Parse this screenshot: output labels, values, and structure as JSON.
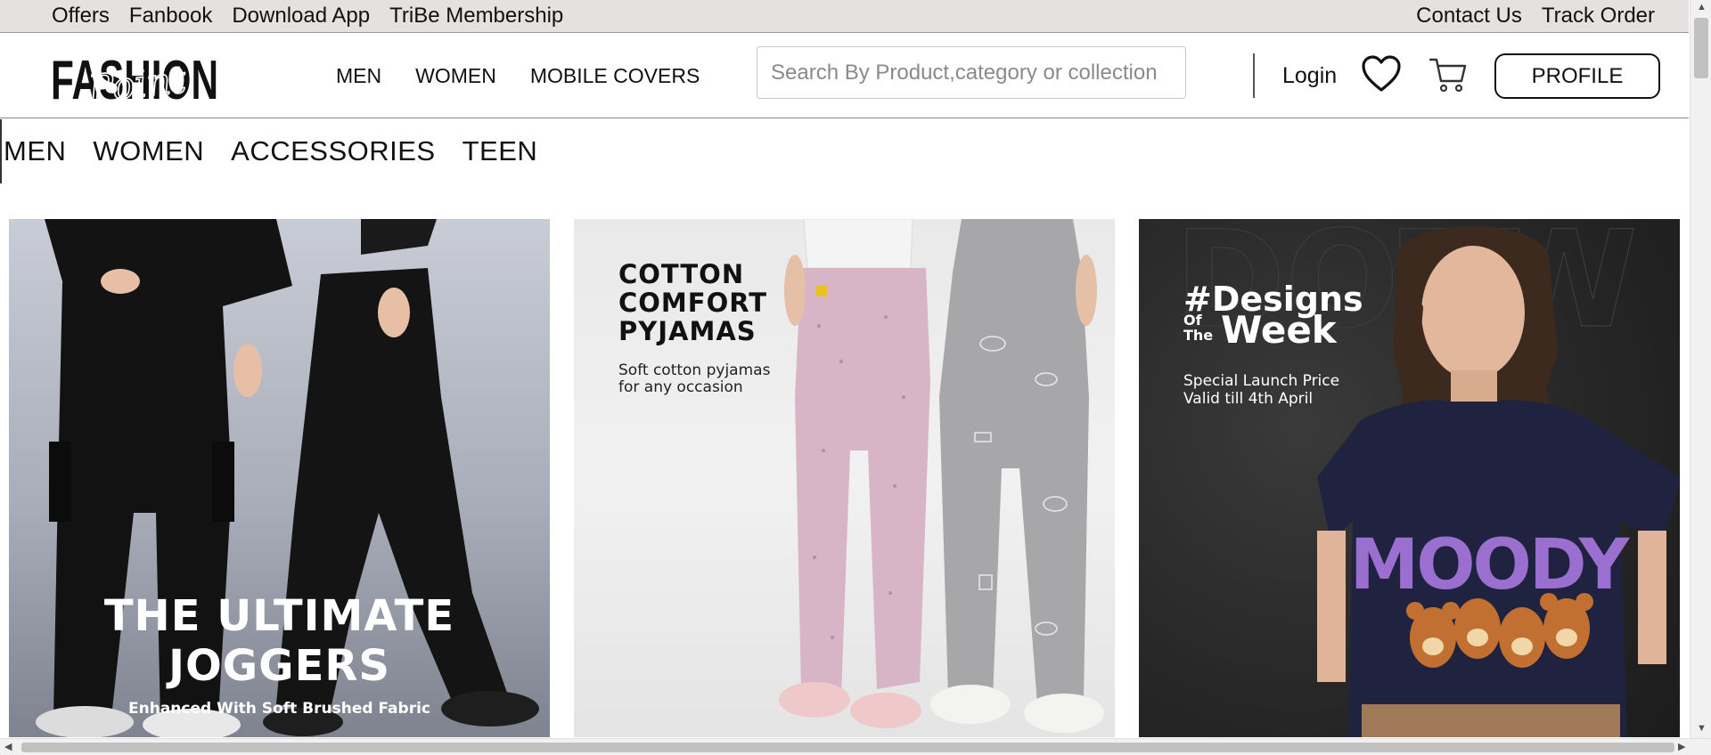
{
  "topbar": {
    "left_links": [
      "Offers",
      "Fanbook",
      "Download App",
      "TriBe Membership"
    ],
    "right_links": [
      "Contact Us",
      "Track Order"
    ]
  },
  "header": {
    "logo_text": "FASHION",
    "logo_script": "Point",
    "nav": [
      "MEN",
      "WOMEN",
      "MOBILE COVERS"
    ],
    "search_placeholder": "Search By Product,category or collection",
    "login_label": "Login",
    "wishlist_icon": "heart-icon",
    "cart_icon": "cart-icon",
    "profile_label": "PROFILE"
  },
  "categories": [
    "MEN",
    "WOMEN",
    "ACCESSORIES",
    "TEEN"
  ],
  "banners": [
    {
      "title_lines": [
        "THE ULTIMATE",
        "JOGGERS"
      ],
      "subtitle": "Enhanced With Soft Brushed Fabric"
    },
    {
      "title_lines": [
        "COTTON",
        "COMFORT",
        "PYJAMAS"
      ],
      "subtitle_lines": [
        "Soft cotton pyjamas",
        "for any occasion"
      ]
    },
    {
      "title_hash": "#Designs",
      "title_of": "Of",
      "title_the": "The",
      "title_week": "Week",
      "subtitle_lines": [
        "Special Launch Price",
        "Valid till 4th April"
      ],
      "tshirt_text": "MOODY"
    }
  ],
  "colors": {
    "topbar_bg": "#e6e1e1",
    "banner3_bg": "#262626",
    "moody_purple": "#9b6fd0"
  }
}
